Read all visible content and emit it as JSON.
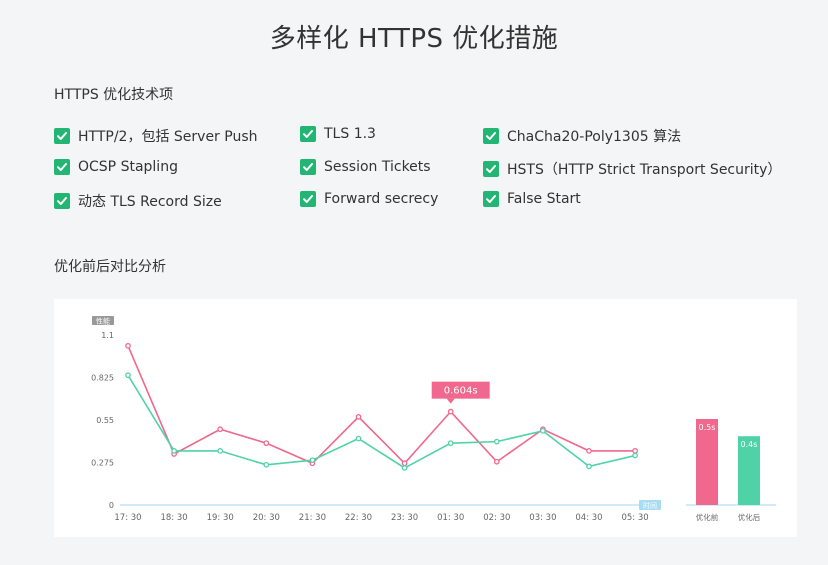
{
  "page": {
    "title": "多样化 HTTPS 优化措施",
    "features_heading": "HTTPS 优化技术项",
    "chart_heading": "优化前后对比分析"
  },
  "features": [
    "HTTP/2，包括 Server Push",
    "TLS 1.3",
    "ChaCha20-Poly1305 算法",
    "OCSP Stapling",
    "Session Tickets",
    "HSTS（HTTP Strict Transport Security）",
    "动态 TLS Record Size",
    "Forward secrecy",
    "False Start"
  ],
  "colors": {
    "accent_check": "#22b573",
    "before": "#f0688d",
    "after": "#4fd3a6"
  },
  "chart_data": [
    {
      "type": "line",
      "ylabel": "性能",
      "xlabel": "时间",
      "ylim": [
        0,
        1.1
      ],
      "yticks": [
        "0",
        "0.275",
        "0.55",
        "0.825",
        "1.1"
      ],
      "categories": [
        "17: 30",
        "18: 30",
        "19: 30",
        "20: 30",
        "21: 30",
        "22: 30",
        "23: 30",
        "01: 30",
        "02: 30",
        "03: 30",
        "04: 30",
        "05: 30"
      ],
      "series": [
        {
          "values": [
            1.03,
            0.33,
            0.49,
            0.4,
            0.27,
            0.57,
            0.27,
            0.604,
            0.28,
            0.49,
            0.35,
            0.35
          ]
        },
        {
          "values": [
            0.84,
            0.35,
            0.35,
            0.26,
            0.29,
            0.43,
            0.24,
            0.4,
            0.41,
            0.48,
            0.25,
            0.32
          ]
        }
      ],
      "tooltip": {
        "index": 7,
        "label": "0.604s"
      },
      "grid": false
    },
    {
      "type": "bar",
      "categories": [
        "优化前",
        "优化后"
      ],
      "values": [
        0.5,
        0.4
      ],
      "data_labels": [
        "0.5s",
        "0.4s"
      ]
    }
  ]
}
